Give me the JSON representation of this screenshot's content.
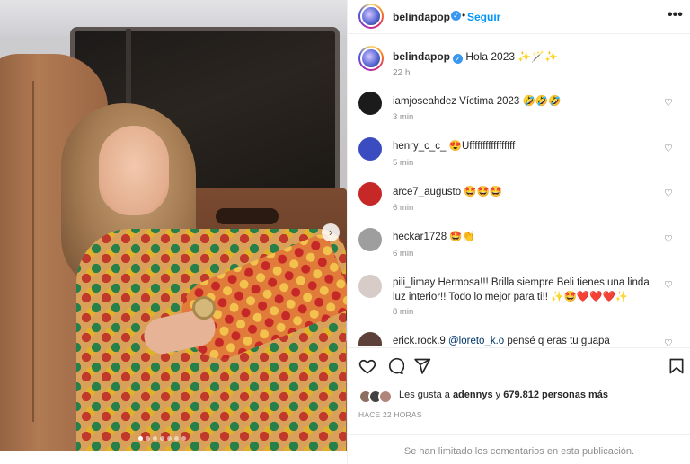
{
  "header": {
    "username": "belindapop",
    "follow_label": "Seguir",
    "separator": "•",
    "more_label": "•••"
  },
  "caption": {
    "username": "belindapop",
    "text": "Hola 2023 ✨🪄✨",
    "time": "22 h"
  },
  "comments": [
    {
      "user": "iamjoseahdez",
      "text": "Víctima 2023 🤣🤣🤣",
      "time": "3 min",
      "avatar_color": "#1b1b1b"
    },
    {
      "user": "henry_c_c_",
      "text": "😍Ufffffffffffffffff",
      "time": "5 min",
      "avatar_color": "#3b4cc0"
    },
    {
      "user": "arce7_augusto",
      "text": "🤩🤩🤩",
      "time": "6 min",
      "avatar_color": "#c62828"
    },
    {
      "user": "heckar1728",
      "text": "🤩👏",
      "time": "6 min",
      "avatar_color": "#9e9e9e"
    },
    {
      "user": "pili_limay",
      "text": "Hermosa!!! Brilla siempre Beli tienes una linda luz interior!! Todo lo mejor para ti!!  ✨🤩❤️❤️❤️✨",
      "time": "8 min",
      "avatar_color": "#d7ccc8"
    },
    {
      "user": "erick.rock.9",
      "mention": "@loreto_k.o",
      "text": " pensé q eras tu guapa",
      "avatar_color": "#5d4037"
    }
  ],
  "likes": {
    "prefix": "Les gusta a ",
    "user": "adennys",
    "middle": " y ",
    "count": "679.812 personas más"
  },
  "posted_ago": "HACE 22 HORAS",
  "comments_limited": "Se han limitado los comentarios en esta publicación.",
  "icons": {
    "heart": "heart-outline-icon",
    "comment": "comment-icon",
    "share": "paper-plane-icon",
    "save": "bookmark-icon"
  },
  "carousel": {
    "total_slides": 7,
    "active_slide": 1
  },
  "colors": {
    "accent": "#0095f6",
    "verified": "#3897f0",
    "muted": "#8e8e8e"
  }
}
